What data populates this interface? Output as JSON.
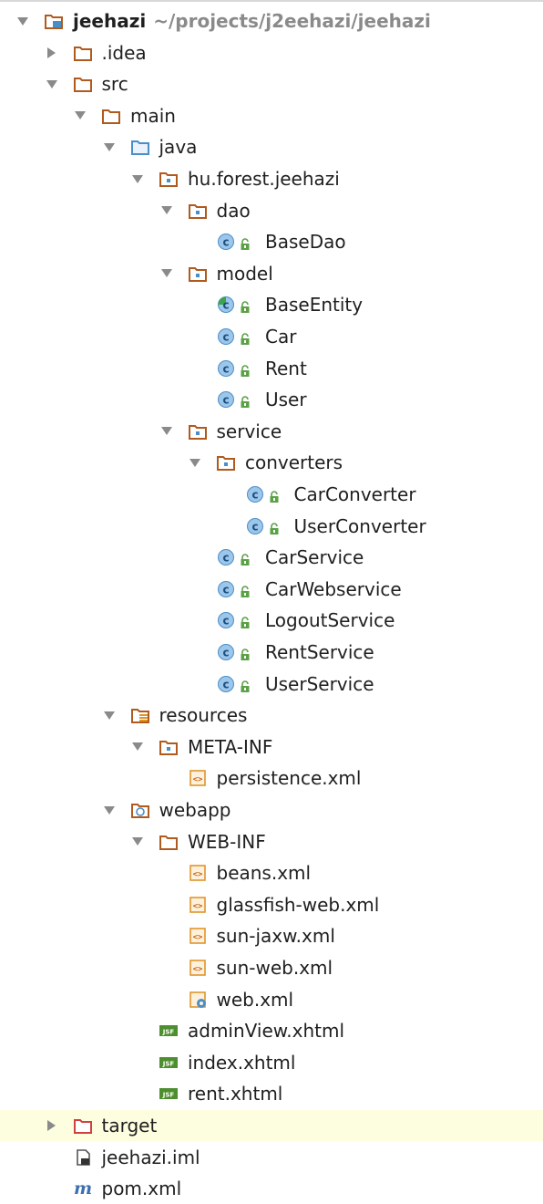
{
  "project": {
    "name": "jeehazi",
    "path": "~/projects/j2eehazi/jeehazi"
  },
  "tree": [
    {
      "label": "jeehazi",
      "icon": "module-folder",
      "depth": 0,
      "arrow": "open",
      "bold": true
    },
    {
      "label": ".idea",
      "icon": "folder",
      "depth": 1,
      "arrow": "closed"
    },
    {
      "label": "src",
      "icon": "folder",
      "depth": 1,
      "arrow": "open"
    },
    {
      "label": "main",
      "icon": "folder",
      "depth": 2,
      "arrow": "open"
    },
    {
      "label": "java",
      "icon": "source-folder",
      "depth": 3,
      "arrow": "open"
    },
    {
      "label": "hu.forest.jeehazi",
      "icon": "package",
      "depth": 4,
      "arrow": "open"
    },
    {
      "label": "dao",
      "icon": "package",
      "depth": 5,
      "arrow": "open"
    },
    {
      "label": "BaseDao",
      "icon": "class",
      "depth": 6
    },
    {
      "label": "model",
      "icon": "package",
      "depth": 5,
      "arrow": "open"
    },
    {
      "label": "BaseEntity",
      "icon": "abstract-class",
      "depth": 6
    },
    {
      "label": "Car",
      "icon": "class",
      "depth": 6
    },
    {
      "label": "Rent",
      "icon": "class",
      "depth": 6
    },
    {
      "label": "User",
      "icon": "class",
      "depth": 6
    },
    {
      "label": "service",
      "icon": "package",
      "depth": 5,
      "arrow": "open"
    },
    {
      "label": "converters",
      "icon": "package",
      "depth": 6,
      "arrow": "open"
    },
    {
      "label": "CarConverter",
      "icon": "class",
      "depth": 7
    },
    {
      "label": "UserConverter",
      "icon": "class",
      "depth": 7
    },
    {
      "label": "CarService",
      "icon": "class",
      "depth": 6
    },
    {
      "label": "CarWebservice",
      "icon": "class",
      "depth": 6
    },
    {
      "label": "LogoutService",
      "icon": "class",
      "depth": 6
    },
    {
      "label": "RentService",
      "icon": "class",
      "depth": 6
    },
    {
      "label": "UserService",
      "icon": "class",
      "depth": 6
    },
    {
      "label": "resources",
      "icon": "resources-folder",
      "depth": 3,
      "arrow": "open"
    },
    {
      "label": "META-INF",
      "icon": "package",
      "depth": 4,
      "arrow": "open"
    },
    {
      "label": "persistence.xml",
      "icon": "xml-file",
      "depth": 5
    },
    {
      "label": "webapp",
      "icon": "web-folder",
      "depth": 3,
      "arrow": "open"
    },
    {
      "label": "WEB-INF",
      "icon": "folder",
      "depth": 4,
      "arrow": "open"
    },
    {
      "label": "beans.xml",
      "icon": "xml-file",
      "depth": 5
    },
    {
      "label": "glassfish-web.xml",
      "icon": "xml-file",
      "depth": 5
    },
    {
      "label": "sun-jaxw.xml",
      "icon": "xml-file",
      "depth": 5
    },
    {
      "label": "sun-web.xml",
      "icon": "xml-file",
      "depth": 5
    },
    {
      "label": "web.xml",
      "icon": "web-xml-file",
      "depth": 5
    },
    {
      "label": "adminView.xhtml",
      "icon": "jsf-file",
      "depth": 4
    },
    {
      "label": "index.xhtml",
      "icon": "jsf-file",
      "depth": 4
    },
    {
      "label": "rent.xhtml",
      "icon": "jsf-file",
      "depth": 4
    },
    {
      "label": "target",
      "icon": "excluded-folder",
      "depth": 1,
      "arrow": "closed",
      "selected": true
    },
    {
      "label": "jeehazi.iml",
      "icon": "iml-file",
      "depth": 1
    },
    {
      "label": "pom.xml",
      "icon": "maven-file",
      "depth": 1
    }
  ],
  "colors": {
    "folder": "#b05a1e",
    "source_folder": "#4a8ec8",
    "class_bg": "#9cc6ea",
    "class_border": "#4a8ec8",
    "lock_green": "#5aa045",
    "xml_orange": "#e0952a",
    "jsf_green": "#4d8f2e",
    "excluded": "#d04040",
    "selected_bg": "#fdfde0"
  }
}
